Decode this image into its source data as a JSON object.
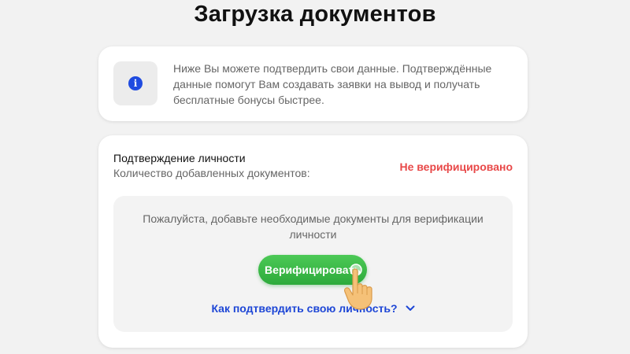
{
  "page": {
    "title": "Загрузка документов"
  },
  "info": {
    "icon": "info-icon",
    "icon_glyph": "i",
    "text": "Ниже Вы можете подтвердить свои данные. Подтверждённые данные помогут Вам создавать заявки на вывод и получать бесплатные бонусы быстрее."
  },
  "verification": {
    "title": "Подтверждение личности",
    "documents_label": "Количество добавленных документов:",
    "status": "Не верифицировано",
    "prompt": "Пожалуйста, добавьте необходимые документы для верификации личности",
    "button_label": "Верифицировать",
    "help_link": "Как подтвердить свою личность?"
  },
  "colors": {
    "accent_blue": "#1d46d6",
    "button_green": "#2daa3b",
    "status_red": "#e84848",
    "background": "#f2f2f2"
  },
  "icons": {
    "cursor": "pointing-hand-cursor-icon",
    "expand": "chevron-down-icon"
  }
}
